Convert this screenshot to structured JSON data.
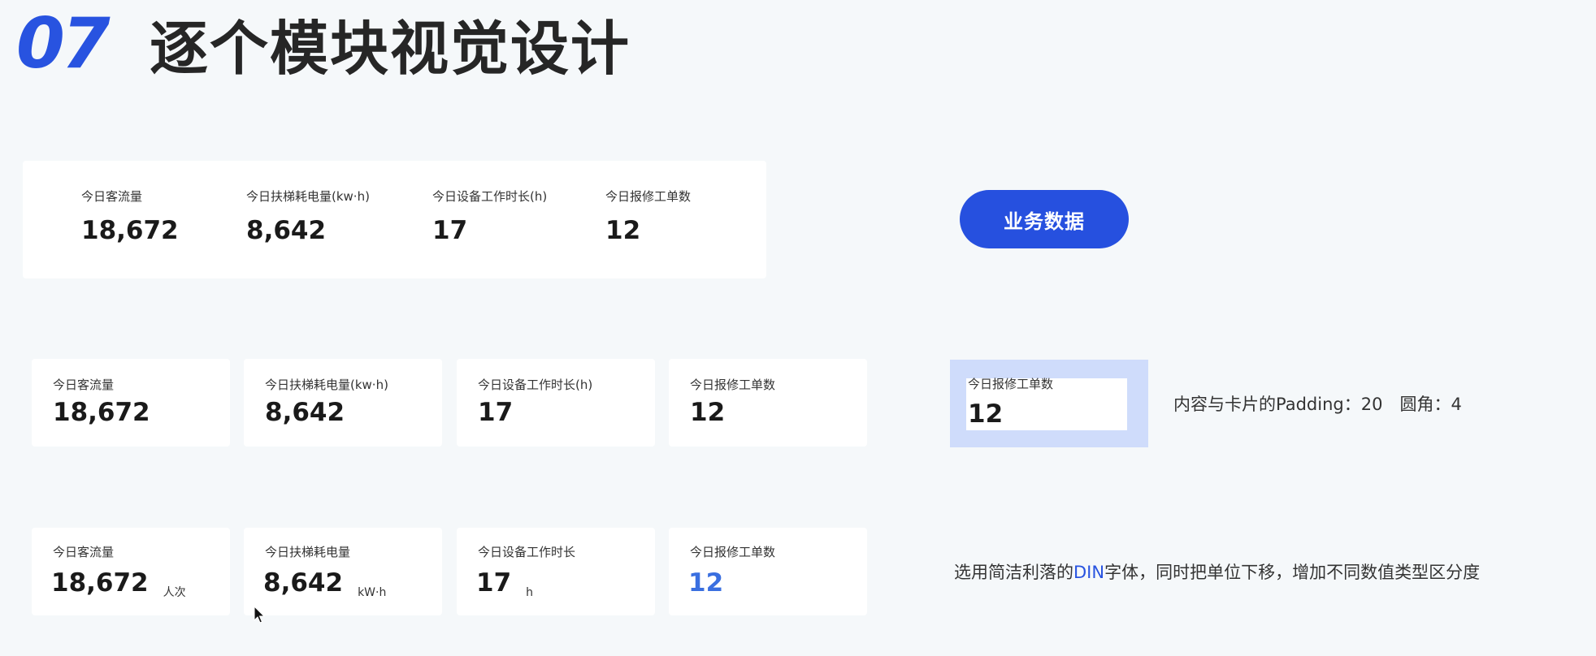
{
  "header": {
    "number": "07",
    "title": "逐个模块视觉设计"
  },
  "row1": {
    "items": [
      {
        "label": "今日客流量",
        "value": "18,672"
      },
      {
        "label": "今日扶梯耗电量(kw·h)",
        "value": "8,642"
      },
      {
        "label": "今日设备工作时长(h)",
        "value": "17"
      },
      {
        "label": "今日报修工单数",
        "value": "12"
      }
    ]
  },
  "row2": {
    "items": [
      {
        "label": "今日客流量",
        "value": "18,672"
      },
      {
        "label": "今日扶梯耗电量(kw·h)",
        "value": "8,642"
      },
      {
        "label": "今日设备工作时长(h)",
        "value": "17"
      },
      {
        "label": "今日报修工单数",
        "value": "12"
      }
    ]
  },
  "row3": {
    "items": [
      {
        "label": "今日客流量",
        "value": "18,672",
        "unit": "人次"
      },
      {
        "label": "今日扶梯耗电量",
        "value": "8,642",
        "unit": "kW·h"
      },
      {
        "label": "今日设备工作时长",
        "value": "17",
        "unit": "h"
      },
      {
        "label": "今日报修工单数",
        "value": "12",
        "unit": ""
      }
    ],
    "highlight_color": "#3a6fe0"
  },
  "button": {
    "label": "业务数据",
    "color": "#2650df"
  },
  "padding_demo": {
    "label": "今日报修工单数",
    "value": "12",
    "note": "内容与卡片的Padding：20　圆角：4"
  },
  "font_note": {
    "before": "选用简洁利落的",
    "highlight": "DIN",
    "after": "字体，同时把单位下移，增加不同数值类型区分度"
  },
  "colors": {
    "accent": "#2853e0",
    "background": "#f5f8fa",
    "padding_highlight": "#cfdcfb"
  }
}
